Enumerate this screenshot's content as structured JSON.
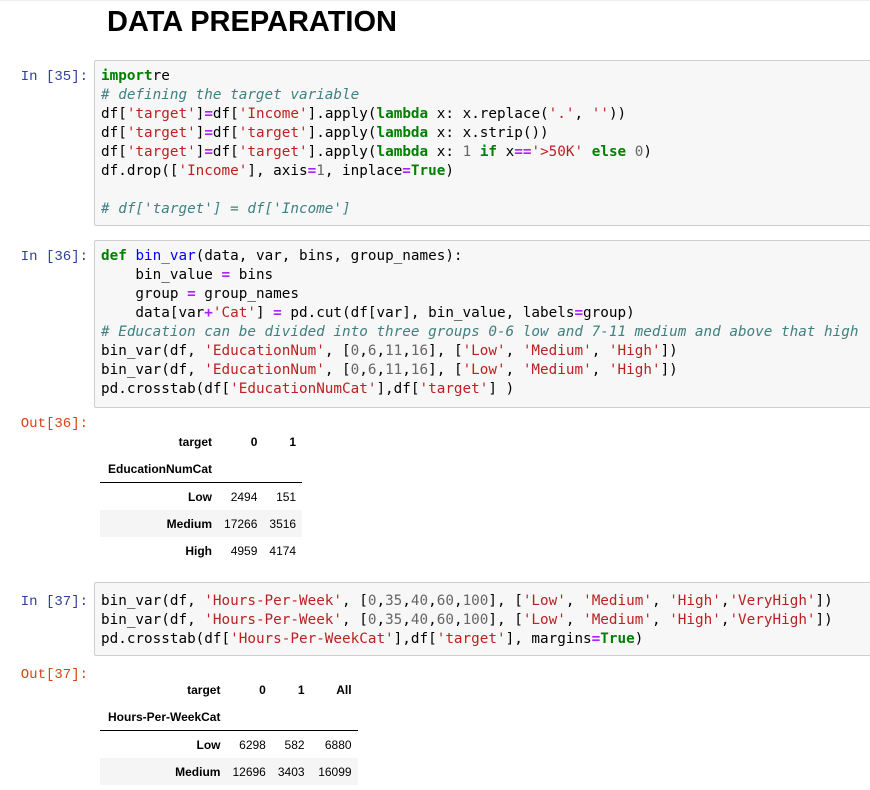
{
  "heading": "DATA PREPARATION",
  "cells": {
    "c35": {
      "prompt": "In [35]:",
      "code": [
        [
          [
            "kw",
            "import"
          ],
          [
            "",
            "re"
          ]
        ],
        [
          [
            "cm",
            "# defining the target variable"
          ]
        ],
        [
          [
            "",
            "df["
          ],
          [
            "st",
            "'target'"
          ],
          [
            "",
            "]"
          ],
          [
            "op",
            "="
          ],
          [
            "",
            "df["
          ],
          [
            "st",
            "'Income'"
          ],
          [
            "",
            "].apply("
          ],
          [
            "kw",
            "lambda"
          ],
          [
            "",
            " x: x.replace("
          ],
          [
            "st",
            "'.'"
          ],
          [
            "",
            ", "
          ],
          [
            "st",
            "''"
          ],
          [
            "",
            "))"
          ]
        ],
        [
          [
            "",
            "df["
          ],
          [
            "st",
            "'target'"
          ],
          [
            "",
            "]"
          ],
          [
            "op",
            "="
          ],
          [
            "",
            "df["
          ],
          [
            "st",
            "'target'"
          ],
          [
            "",
            "].apply("
          ],
          [
            "kw",
            "lambda"
          ],
          [
            "",
            " x: x.strip())"
          ]
        ],
        [
          [
            "",
            "df["
          ],
          [
            "st",
            "'target'"
          ],
          [
            "",
            "]"
          ],
          [
            "op",
            "="
          ],
          [
            "",
            "df["
          ],
          [
            "st",
            "'target'"
          ],
          [
            "",
            "].apply("
          ],
          [
            "kw",
            "lambda"
          ],
          [
            "",
            " x: "
          ],
          [
            "nu",
            "1"
          ],
          [
            "",
            " "
          ],
          [
            "kw",
            "if"
          ],
          [
            "",
            " x"
          ],
          [
            "op",
            "=="
          ],
          [
            "st",
            "'>50K'"
          ],
          [
            "",
            " "
          ],
          [
            "kw",
            "else"
          ],
          [
            "",
            " "
          ],
          [
            "nu",
            "0"
          ],
          [
            "",
            ")"
          ]
        ],
        [
          [
            "",
            "df.drop(["
          ],
          [
            "st",
            "'Income'"
          ],
          [
            "",
            "], axis"
          ],
          [
            "op",
            "="
          ],
          [
            "nu",
            "1"
          ],
          [
            "",
            ", inplace"
          ],
          [
            "op",
            "="
          ],
          [
            "kw",
            "True"
          ],
          [
            "",
            ")"
          ]
        ],
        [],
        [
          [
            "cm",
            "# df['target'] = df['Income']"
          ]
        ]
      ]
    },
    "c36": {
      "prompt": "In [36]:",
      "out_prompt": "Out[36]:",
      "code": [
        [
          [
            "kw",
            "def"
          ],
          [
            "",
            " "
          ],
          [
            "fn",
            "bin_var"
          ],
          [
            "",
            "(data, var, bins, group_names):"
          ]
        ],
        [
          [
            "",
            "    bin_value "
          ],
          [
            "op",
            "="
          ],
          [
            "",
            " bins"
          ]
        ],
        [
          [
            "",
            "    group "
          ],
          [
            "op",
            "="
          ],
          [
            "",
            " group_names"
          ]
        ],
        [
          [
            "",
            "    data[var"
          ],
          [
            "op",
            "+"
          ],
          [
            "st",
            "'Cat'"
          ],
          [
            "",
            "] "
          ],
          [
            "op",
            "="
          ],
          [
            "",
            " pd.cut(df[var], bin_value, labels"
          ],
          [
            "op",
            "="
          ],
          [
            "",
            "group)"
          ]
        ],
        [
          [
            "cm",
            "# Education can be divided into three groups 0-6 low and 7-11 medium and above that high"
          ]
        ],
        [
          [
            "",
            "bin_var(df, "
          ],
          [
            "st",
            "'EducationNum'"
          ],
          [
            "",
            ", ["
          ],
          [
            "nu",
            "0"
          ],
          [
            "",
            ","
          ],
          [
            "nu",
            "6"
          ],
          [
            "",
            ","
          ],
          [
            "nu",
            "11"
          ],
          [
            "",
            ","
          ],
          [
            "nu",
            "16"
          ],
          [
            "",
            "], ["
          ],
          [
            "st",
            "'Low'"
          ],
          [
            "",
            ", "
          ],
          [
            "st",
            "'Medium'"
          ],
          [
            "",
            ", "
          ],
          [
            "st",
            "'High'"
          ],
          [
            "",
            "])"
          ]
        ],
        [
          [
            "",
            "bin_var(df, "
          ],
          [
            "st",
            "'EducationNum'"
          ],
          [
            "",
            ", ["
          ],
          [
            "nu",
            "0"
          ],
          [
            "",
            ","
          ],
          [
            "nu",
            "6"
          ],
          [
            "",
            ","
          ],
          [
            "nu",
            "11"
          ],
          [
            "",
            ","
          ],
          [
            "nu",
            "16"
          ],
          [
            "",
            "], ["
          ],
          [
            "st",
            "'Low'"
          ],
          [
            "",
            ", "
          ],
          [
            "st",
            "'Medium'"
          ],
          [
            "",
            ", "
          ],
          [
            "st",
            "'High'"
          ],
          [
            "",
            "])"
          ]
        ],
        [
          [
            "",
            "pd.crosstab(df["
          ],
          [
            "st",
            "'EducationNumCat'"
          ],
          [
            "",
            "],df["
          ],
          [
            "st",
            "'target'"
          ],
          [
            "",
            "] )"
          ]
        ]
      ],
      "table": {
        "corner": "target",
        "columns": [
          "0",
          "1"
        ],
        "index_name": "EducationNumCat",
        "rows": [
          {
            "label": "Low",
            "values": [
              "2494",
              "151"
            ]
          },
          {
            "label": "Medium",
            "values": [
              "17266",
              "3516"
            ]
          },
          {
            "label": "High",
            "values": [
              "4959",
              "4174"
            ]
          }
        ]
      }
    },
    "c37": {
      "prompt": "In [37]:",
      "out_prompt": "Out[37]:",
      "code": [
        [
          [
            "",
            "bin_var(df, "
          ],
          [
            "st",
            "'Hours-Per-Week'"
          ],
          [
            "",
            ", ["
          ],
          [
            "nu",
            "0"
          ],
          [
            "",
            ","
          ],
          [
            "nu",
            "35"
          ],
          [
            "",
            ","
          ],
          [
            "nu",
            "40"
          ],
          [
            "",
            ","
          ],
          [
            "nu",
            "60"
          ],
          [
            "",
            ","
          ],
          [
            "nu",
            "100"
          ],
          [
            "",
            "], ["
          ],
          [
            "st",
            "'Low'"
          ],
          [
            "",
            ", "
          ],
          [
            "st",
            "'Medium'"
          ],
          [
            "",
            ", "
          ],
          [
            "st",
            "'High'"
          ],
          [
            "",
            ","
          ],
          [
            "st",
            "'VeryHigh'"
          ],
          [
            "",
            "])"
          ]
        ],
        [
          [
            "",
            "bin_var(df, "
          ],
          [
            "st",
            "'Hours-Per-Week'"
          ],
          [
            "",
            ", ["
          ],
          [
            "nu",
            "0"
          ],
          [
            "",
            ","
          ],
          [
            "nu",
            "35"
          ],
          [
            "",
            ","
          ],
          [
            "nu",
            "40"
          ],
          [
            "",
            ","
          ],
          [
            "nu",
            "60"
          ],
          [
            "",
            ","
          ],
          [
            "nu",
            "100"
          ],
          [
            "",
            "], ["
          ],
          [
            "st",
            "'Low'"
          ],
          [
            "",
            ", "
          ],
          [
            "st",
            "'Medium'"
          ],
          [
            "",
            ", "
          ],
          [
            "st",
            "'High'"
          ],
          [
            "",
            ","
          ],
          [
            "st",
            "'VeryHigh'"
          ],
          [
            "",
            "])"
          ]
        ],
        [
          [
            "",
            "pd.crosstab(df["
          ],
          [
            "st",
            "'Hours-Per-WeekCat'"
          ],
          [
            "",
            "],df["
          ],
          [
            "st",
            "'target'"
          ],
          [
            "",
            "], margins"
          ],
          [
            "op",
            "="
          ],
          [
            "kw",
            "True"
          ],
          [
            "",
            ")"
          ]
        ]
      ],
      "table": {
        "corner": "target",
        "columns": [
          "0",
          "1",
          "All"
        ],
        "index_name": "Hours-Per-WeekCat",
        "rows": [
          {
            "label": "Low",
            "values": [
              "6298",
              "582",
              "6880"
            ]
          },
          {
            "label": "Medium",
            "values": [
              "12696",
              "3403",
              "16099"
            ]
          }
        ]
      }
    }
  }
}
